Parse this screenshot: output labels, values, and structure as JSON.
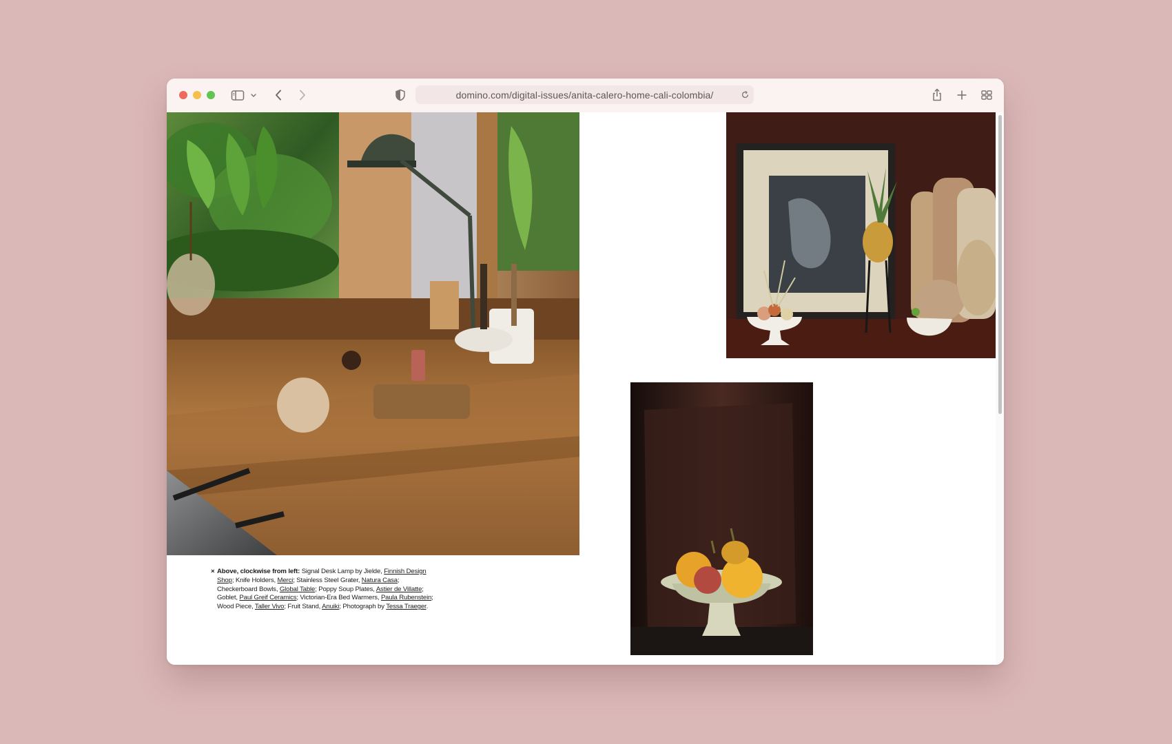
{
  "browser": {
    "url": "domino.com/digital-issues/anita-calero-home-cali-colombia/",
    "icons": [
      "sidebar-toggle-icon",
      "chevron-down-icon",
      "back-arrow-icon",
      "forward-arrow-icon",
      "privacy-shield-icon",
      "reload-icon",
      "share-icon",
      "new-tab-plus-icon",
      "tab-overview-icon"
    ]
  },
  "colors": {
    "desktop_background": "#dbb8b8",
    "accent_panel": "#9a4642",
    "toolbar": "#fbf2f2"
  },
  "article": {
    "caption": {
      "marker": "×",
      "lead": "Above, clockwise from left:",
      "lines": [
        [
          {
            "t": "Signal Desk Lamp by Jielde, "
          },
          {
            "t": "Finnish Design Shop",
            "link": true
          },
          {
            "t": "; Knife Holders, "
          },
          {
            "t": "Merci",
            "link": true
          },
          {
            "t": "; Stainless Steel Grater, "
          },
          {
            "t": "Natura Casa",
            "link": true
          },
          {
            "t": "; Checkerboard Bowls, "
          },
          {
            "t": "Global Table",
            "link": true
          },
          {
            "t": "; Poppy Soup Plates, "
          },
          {
            "t": "Astier de Villatte",
            "link": true
          },
          {
            "t": "; Goblet, "
          },
          {
            "t": "Paul Greif Ceramics",
            "link": true
          },
          {
            "t": "; Victorian-Era Bed Warmers, "
          },
          {
            "t": "Paula Rubenstein",
            "link": true
          },
          {
            "t": "; Wood Piece, "
          },
          {
            "t": "Taller Vivo",
            "link": true
          },
          {
            "t": "; Fruit Stand, "
          },
          {
            "t": "Anuiki",
            "link": true
          },
          {
            "t": "; Photograph by "
          },
          {
            "t": "Tessa Traeger",
            "link": true
          },
          {
            "t": "."
          }
        ]
      ]
    }
  }
}
